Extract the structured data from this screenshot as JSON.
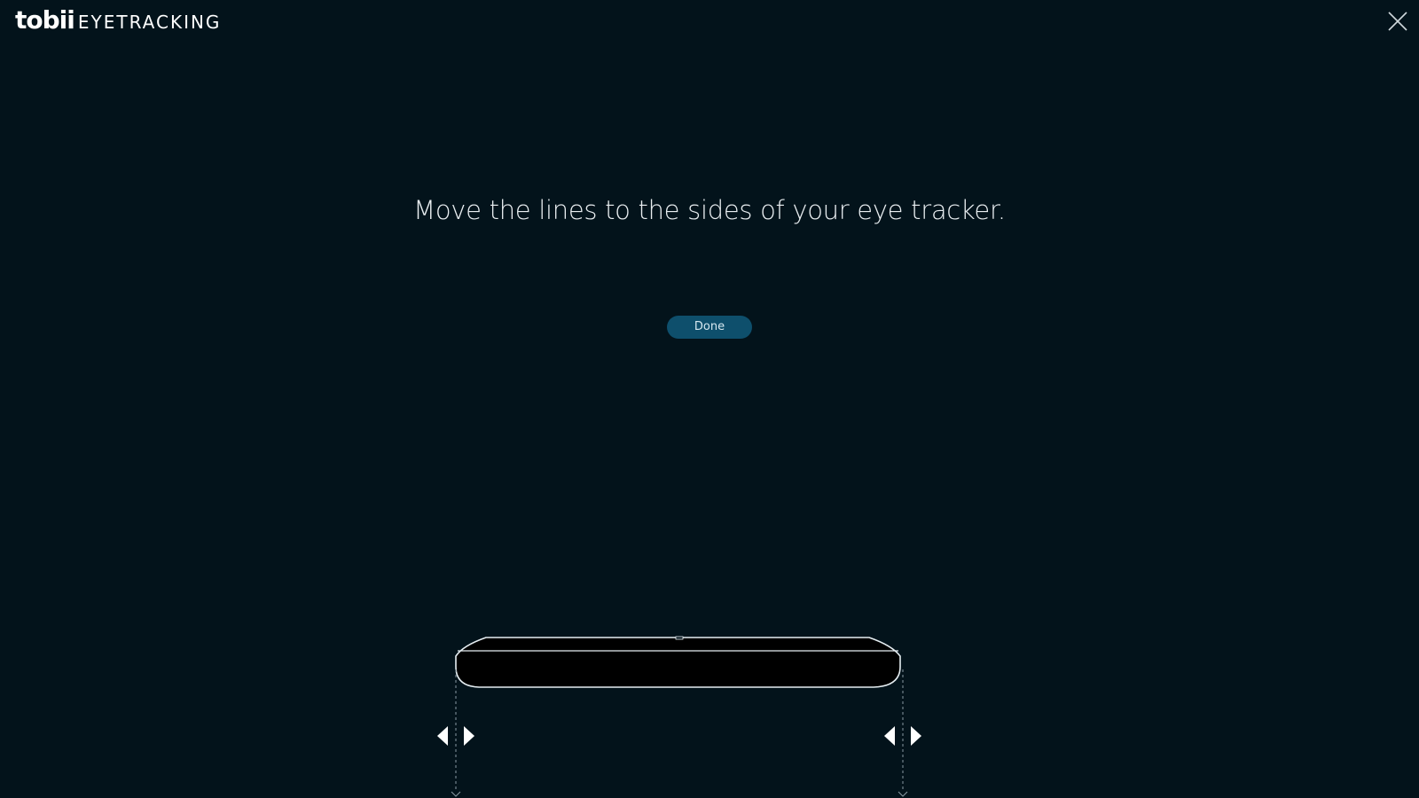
{
  "header": {
    "brand": "tobii",
    "product": "EYETRACKING"
  },
  "instruction": "Move the lines to the sides of your eye tracker.",
  "done_button": "Done",
  "icons": {
    "close": "close-icon",
    "left_arrow": "arrow-left-icon",
    "right_arrow": "arrow-right-icon"
  },
  "colors": {
    "background": "#03131b",
    "button": "#0e4f6c",
    "text": "#e9eef1"
  }
}
